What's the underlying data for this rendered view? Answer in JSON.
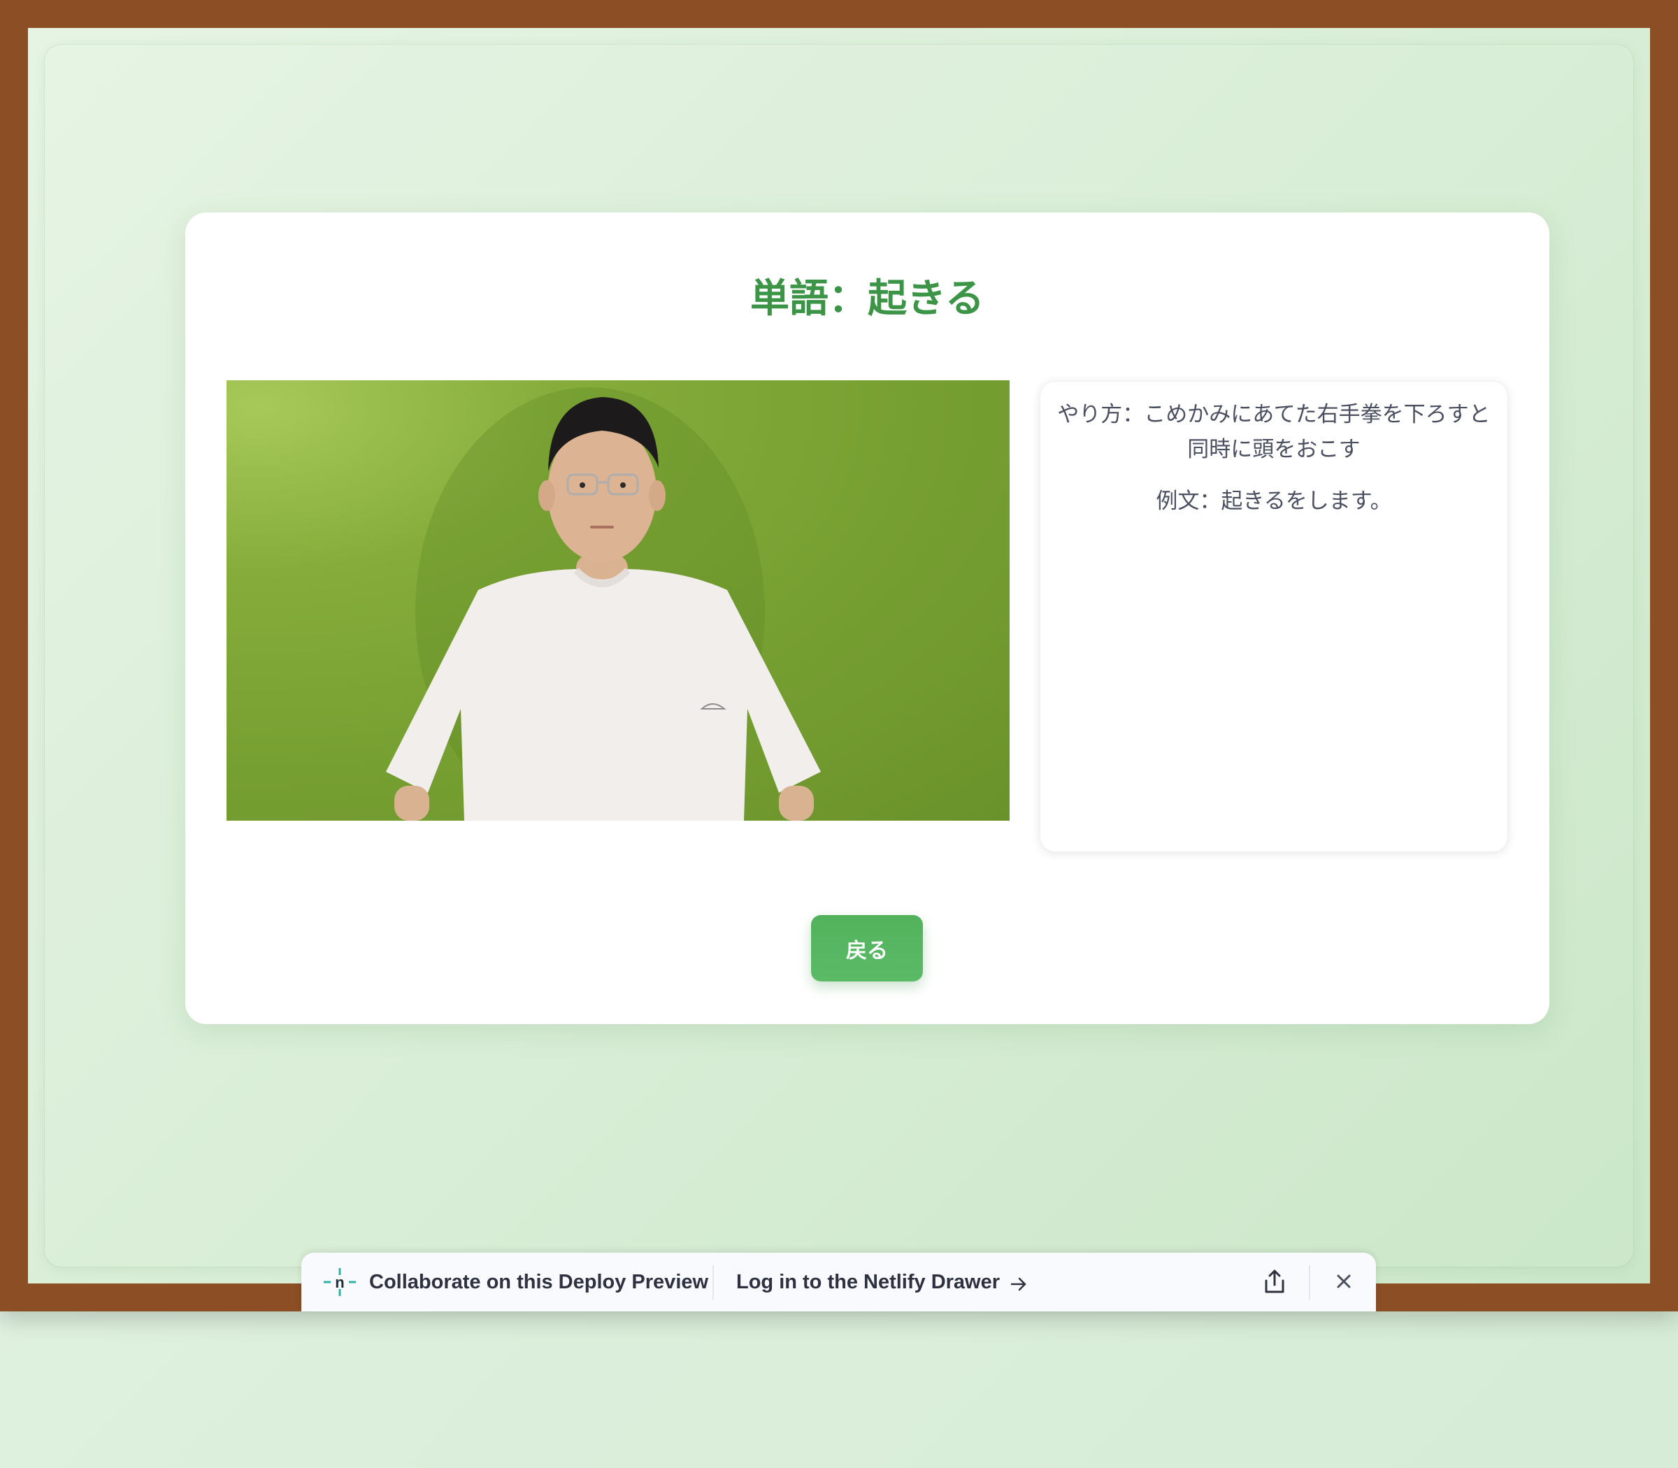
{
  "page": {
    "title": "単語：起きる",
    "back_button_label": "戻る"
  },
  "video": {
    "subject": "person in white t-shirt in front of green screen demonstrating sign"
  },
  "info": {
    "method": "やり方：こめかみにあてた右手拳を下ろすと同時に頭をおこす",
    "example": "例文：起きるをします。"
  },
  "netlify_drawer": {
    "collaborate_text": "Collaborate on this Deploy Preview",
    "login_text": "Log in to the Netlify Drawer",
    "icons": {
      "logo": "netlify-logo-icon",
      "arrow": "arrow-right-icon",
      "share": "share-icon",
      "close": "close-icon"
    }
  },
  "colors": {
    "frame": "#8b4e25",
    "accent": "#3c9447",
    "button": "#55b45f"
  }
}
